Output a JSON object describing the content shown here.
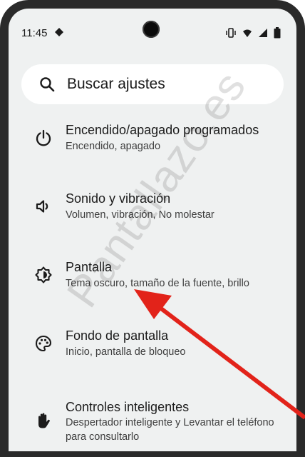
{
  "status": {
    "time": "11:45"
  },
  "search": {
    "placeholder": "Buscar ajustes"
  },
  "items": [
    {
      "title": "Encendido/apagado programados",
      "subtitle": "Encendido, apagado",
      "icon": "power-icon"
    },
    {
      "title": "Sonido y vibración",
      "subtitle": "Volumen, vibración, No molestar",
      "icon": "volume-icon"
    },
    {
      "title": "Pantalla",
      "subtitle": "Tema oscuro, tamaño de la fuente, brillo",
      "icon": "brightness-icon"
    },
    {
      "title": "Fondo de pantalla",
      "subtitle": "Inicio, pantalla de bloqueo",
      "icon": "palette-icon"
    },
    {
      "title": "Controles inteligentes",
      "subtitle": "Despertador inteligente y Levantar el teléfono para consultarlo",
      "icon": "hand-icon"
    }
  ],
  "watermark": "Pantallazo.es",
  "colors": {
    "arrow": "#e2231a",
    "background": "#eff1f1",
    "bezel": "#2a2a2a"
  }
}
